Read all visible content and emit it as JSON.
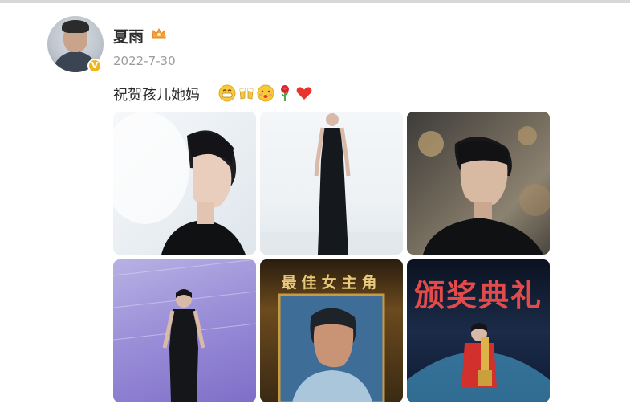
{
  "post": {
    "username": "夏雨",
    "date": "2022-7-30",
    "text": "祝贺孩儿她妈",
    "emojis": [
      "grin-emoji",
      "cheers-emoji",
      "kiss-emoji",
      "rose-emoji",
      "heart-emoji"
    ]
  },
  "photos": [
    {
      "name": "photo-1"
    },
    {
      "name": "photo-2"
    },
    {
      "name": "photo-3"
    },
    {
      "name": "photo-4"
    },
    {
      "name": "photo-5",
      "caption": "最佳女主角"
    },
    {
      "name": "photo-6",
      "caption": "颁奖典礼"
    }
  ],
  "colors": {
    "username": "#2b2b2b",
    "date": "#9c9c9c",
    "verified_badge": "#f4b21c",
    "heart": "#e8342f"
  }
}
